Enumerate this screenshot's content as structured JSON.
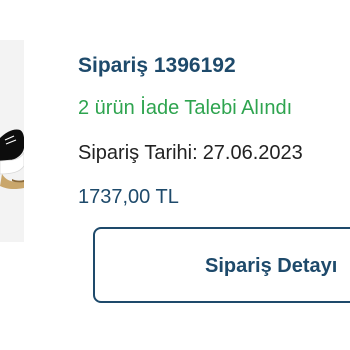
{
  "order": {
    "id_label": "Sipariş 1396192",
    "status": "2 ürün İade Talebi Alındı",
    "date_label": "Sipariş Tarihi:",
    "date_value": "27.06.2023",
    "price": "1737,00 TL"
  },
  "actions": {
    "details_button_label": "Sipariş Detayı"
  },
  "colors": {
    "primary": "#1e4a6b",
    "status_green": "#2ea44f",
    "text": "#222222"
  },
  "icons": {
    "product_image": "sneaker-thumbnail"
  }
}
